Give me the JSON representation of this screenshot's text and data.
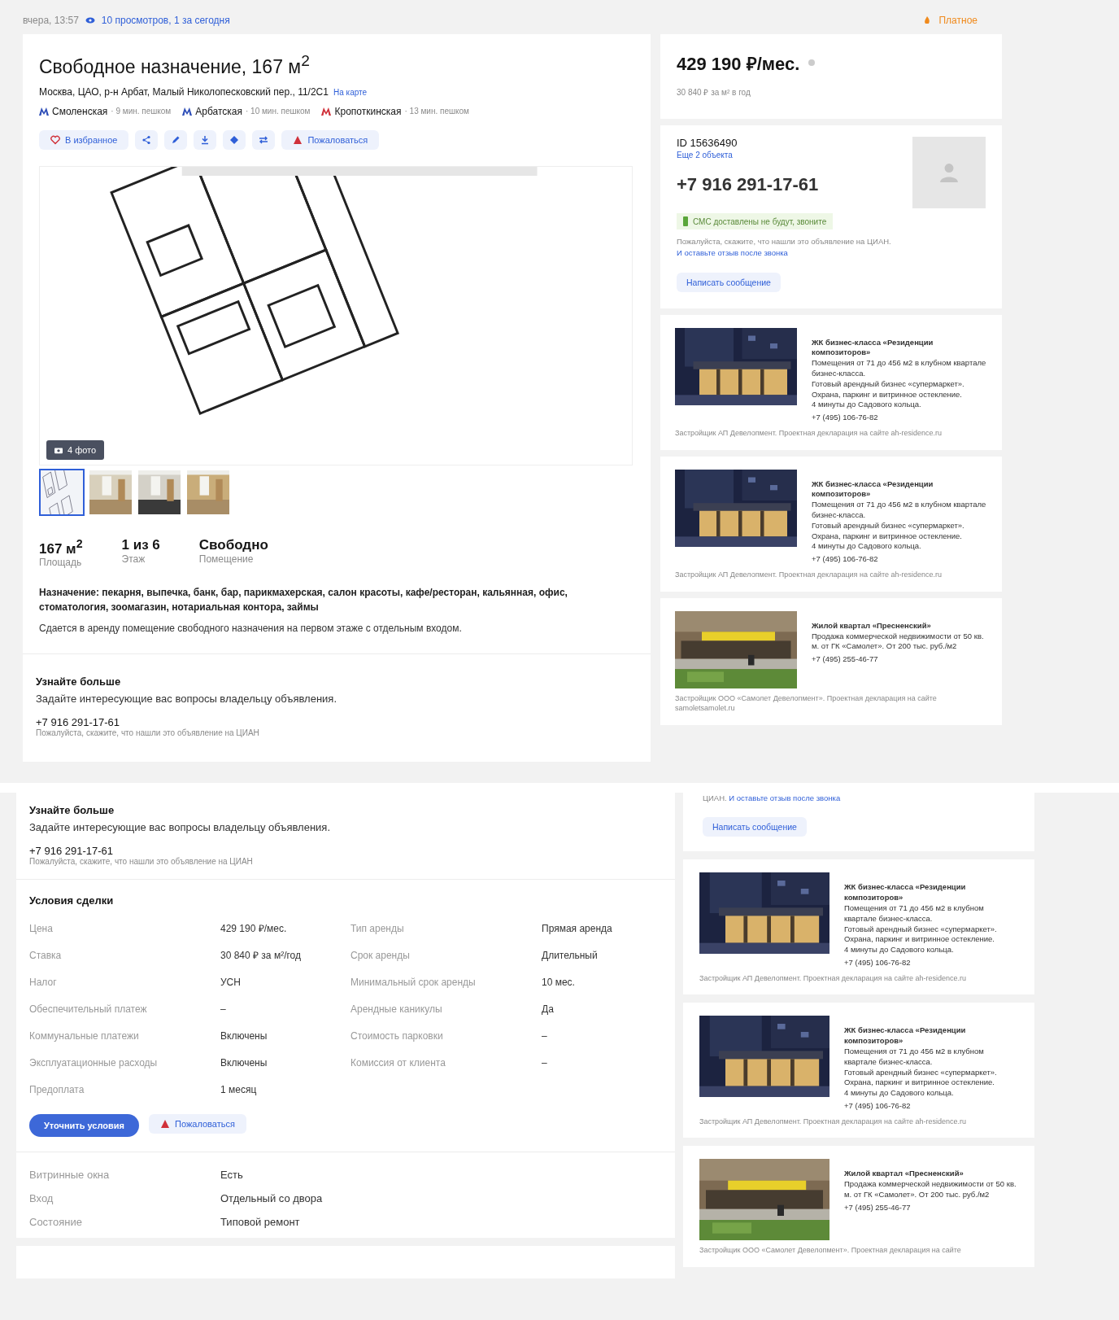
{
  "top_screen": {
    "header": {
      "date": "вчера, 13:57",
      "views": "10 просмотров, 1 за сегодня",
      "paid": "Платное"
    },
    "listing": {
      "title": "Свободное назначение, 167 м$^{2}$",
      "address": "Москва, ЦАО, р-н Арбат, Малый Николопесковский пер., 11/2С1",
      "map_link": "На карте",
      "metro": [
        {
          "name": "Смоленская",
          "time": "· 9 мин. пешком",
          "color": "#2f4fb8"
        },
        {
          "name": "Арбатская",
          "time": "· 10 мин. пешком",
          "color": "#2f4fb8"
        },
        {
          "name": "Кропоткинская",
          "time": "· 13 мин. пешком",
          "color": "#d0313a"
        }
      ],
      "actions": [
        {
          "kind": "favorite",
          "label": "В избранное"
        },
        {
          "kind": "share"
        },
        {
          "kind": "edit"
        },
        {
          "kind": "download"
        },
        {
          "kind": "map"
        },
        {
          "kind": "compare"
        },
        {
          "kind": "complain",
          "label": "Пожаловаться"
        }
      ],
      "photo_count": "4 фото",
      "thumbnails": [
        {
          "selected": true
        },
        {
          "selected": false
        },
        {
          "selected": false
        },
        {
          "selected": false
        }
      ],
      "stats": [
        {
          "value": "167 м$^{2}$",
          "label": "Площадь"
        },
        {
          "value": "1 из 6",
          "label": "Этаж"
        },
        {
          "value": "Свободно",
          "label": "Помещение"
        }
      ],
      "purpose": "Назначение: пекарня, выпечка, банк, бар, парикмахерская, салон красоты, кафе/ресторан, кальянная, офис, стоматология, зоомагазин, нотариальная контора, займы",
      "description": "Сдается в аренду помещение свободного назначения на первом этаже с отдельным входом."
    },
    "learn_more": {
      "title": "Узнайте больше",
      "text": "Задайте интересующие вас вопросы владельцу объявления.",
      "phone": "+7 916 291-17-61",
      "note": "Пожалуйста, скажите, что нашли это объявление на ЦИАН"
    },
    "price": {
      "value": "429 190 ₽/мес.",
      "rate": "30 840 ₽ за м² в год"
    },
    "contact": {
      "id": "ID 15636490",
      "more": "Еще 2 объекта",
      "phone": "+7 916 291-17-61",
      "sms": "СМС доставлены не будут, звоните",
      "note": "Пожалуйста, скажите, что нашли это объявление на",
      "note_tail": "ЦИАН.",
      "note_link": "И оставьте отзыв после звонка",
      "button": "Написать сообщение"
    },
    "ads": [
      {
        "title": "ЖК бизнес-класса «Резиденции композиторов»",
        "lines": [
          "Помещения от 71 до 456 м2 в клубном квартале бизнес-класса.",
          "Готовый арендный бизнес «супермаркет». Охрана, паркинг и витринное остекление.",
          "4 минуты до Садового кольца."
        ],
        "phone": "+7 (495) 106-76-82",
        "footer": "Застройщик АП Девелопмент. Проектная декларация на сайте ah-residence.ru"
      },
      {
        "title": "ЖК бизнес-класса «Резиденции композиторов»",
        "lines": [
          "Помещения от 71 до 456 м2 в клубном квартале бизнес-класса.",
          "Готовый арендный бизнес «супермаркет». Охрана, паркинг и витринное остекление.",
          "4 минуты до Садового кольца."
        ],
        "phone": "+7 (495) 106-76-82",
        "footer": "Застройщик АП Девелопмент. Проектная декларация на сайте ah-residence.ru"
      },
      {
        "title": "Жилой квартал «Пресненский»",
        "lines": [
          "Продажа коммерческой недвижимости от 50 кв. м. от ГК «Самолет». От 200 тыс. руб./м2"
        ],
        "phone": "+7 (495) 255-46-77",
        "footer": "Застройщик ООО «Самолет Девелопмент». Проектная декларация на сайте samoletsamolet.ru"
      }
    ]
  },
  "bottom_screen": {
    "learn_more": {
      "title": "Узнайте больше",
      "text": "Задайте интересующие вас вопросы владельцу объявления.",
      "phone": "+7 916 291-17-61",
      "note": "Пожалуйста, скажите, что нашли это объявление на ЦИАН"
    },
    "terms": {
      "title": "Условия сделки",
      "left": [
        {
          "label": "Цена",
          "value": "429 190 ₽/мес."
        },
        {
          "label": "Ставка",
          "value": "30 840 ₽ за м²/год"
        },
        {
          "label": "Налог",
          "value": "УСН"
        },
        {
          "label": "Обеспечительный платеж",
          "value": "–"
        },
        {
          "label": "Коммунальные платежи",
          "value": "Включены"
        },
        {
          "label": "Эксплуатационные расходы",
          "value": "Включены"
        },
        {
          "label": "Предоплата",
          "value": "1 месяц"
        }
      ],
      "right": [
        {
          "label": "Тип аренды",
          "value": "Прямая аренда"
        },
        {
          "label": "Срок аренды",
          "value": "Длительный"
        },
        {
          "label": "Минимальный срок аренды",
          "value": "10 мес."
        },
        {
          "label": "Арендные каникулы",
          "value": "Да"
        },
        {
          "label": "Стоимость парковки",
          "value": "–"
        },
        {
          "label": "Комиссия от клиента",
          "value": "–"
        }
      ],
      "clarify": "Уточнить условия",
      "complain": "Пожаловаться"
    },
    "details": [
      {
        "label": "Витринные окна",
        "value": "Есть"
      },
      {
        "label": "Вход",
        "value": "Отдельный со двора"
      },
      {
        "label": "Состояние",
        "value": "Типовой ремонт"
      }
    ],
    "contact_tail": {
      "note_tail": "ЦИАН.",
      "note_link": "И оставьте отзыв после звонка",
      "button": "Написать сообщение"
    },
    "ads": [
      {
        "title": "ЖК бизнес-класса «Резиденции композиторов»",
        "lines": [
          "Помещения от 71 до 456 м2 в клубном квартале бизнес-класса.",
          "Готовый арендный бизнес «супермаркет». Охрана, паркинг и витринное остекление.",
          "4 минуты до Садового кольца."
        ],
        "phone": "+7 (495) 106-76-82",
        "footer": "Застройщик АП Девелопмент. Проектная декларация на сайте ah-residence.ru"
      },
      {
        "title": "ЖК бизнес-класса «Резиденции композиторов»",
        "lines": [
          "Помещения от 71 до 456 м2 в клубном квартале бизнес-класса.",
          "Готовый арендный бизнес «супермаркет». Охрана, паркинг и витринное остекление.",
          "4 минуты до Садового кольца."
        ],
        "phone": "+7 (495) 106-76-82",
        "footer": "Застройщик АП Девелопмент. Проектная декларация на сайте ah-residence.ru"
      },
      {
        "title": "Жилой квартал «Пресненский»",
        "lines": [
          "Продажа коммерческой недвижимости от 50 кв. м. от ГК «Самолет». От 200 тыс. руб./м2"
        ],
        "phone": "+7 (495) 255-46-77",
        "footer": "Застройщик ООО «Самолет Девелопмент». Проектная декларация на сайте"
      }
    ]
  }
}
